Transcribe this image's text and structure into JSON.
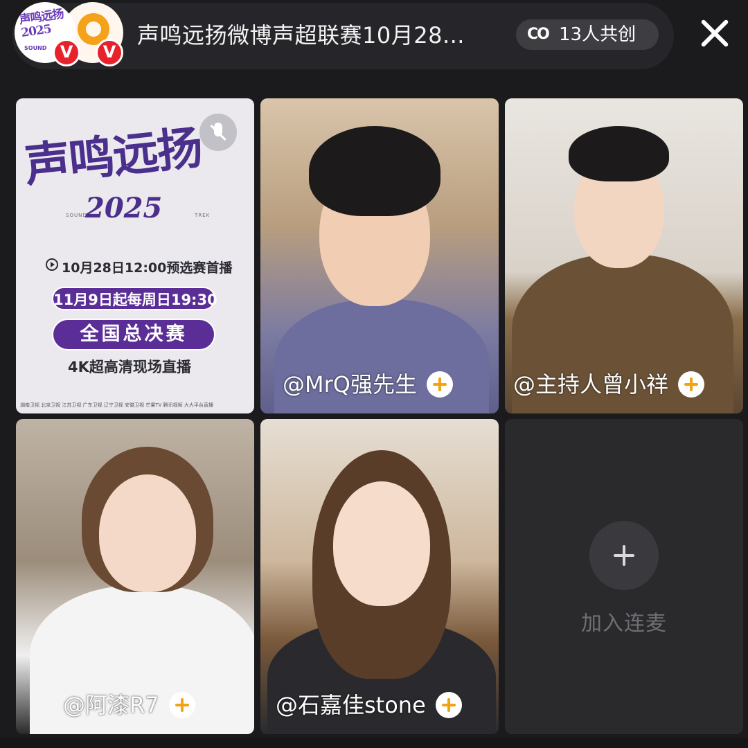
{
  "header": {
    "avatars": [
      {
        "name": "host-avatar-1",
        "logo_text": "声鸣远扬2025",
        "logo_sub": "SOUND",
        "verified": "V"
      },
      {
        "name": "host-avatar-2",
        "verified": "V"
      }
    ],
    "room_title": "声鸣远扬微博声超联赛10月28...",
    "cocreate": {
      "icon": "co-create-icon",
      "icon_glyph": "CO",
      "label": "13人共创"
    },
    "close_icon": "close-icon"
  },
  "tiles": [
    {
      "type": "poster",
      "poster": {
        "title": "声鸣远扬",
        "year": "2025",
        "sound": "SOUND",
        "trek": "TREK",
        "date_line": "10月28日12:00预选赛首播",
        "weekly_line": "11月9日起每周日19:30",
        "final_line": "全国总决赛",
        "stream_line": "4K超高清现场直播",
        "cities_line": "湖南卫视 北京卫视 江苏卫视 广东卫视 辽宁卫视 安徽卫视 芒果TV 腾讯视频 大大平台直播"
      },
      "mute_icon": "mic-muted-icon"
    },
    {
      "type": "guest",
      "name": "@MrQ强先生"
    },
    {
      "type": "guest",
      "name": "@主持人曾小祥"
    },
    {
      "type": "guest",
      "name": "@阿漆R7"
    },
    {
      "type": "guest",
      "name": "@石嘉佳stone"
    },
    {
      "type": "join",
      "label": "加入连麦",
      "icon": "plus-icon"
    }
  ],
  "colors": {
    "background": "#1b1b1d",
    "follow_plus": "#f0a313",
    "verified_badge": "#e8222a",
    "poster_purple": "#5a2e96"
  }
}
